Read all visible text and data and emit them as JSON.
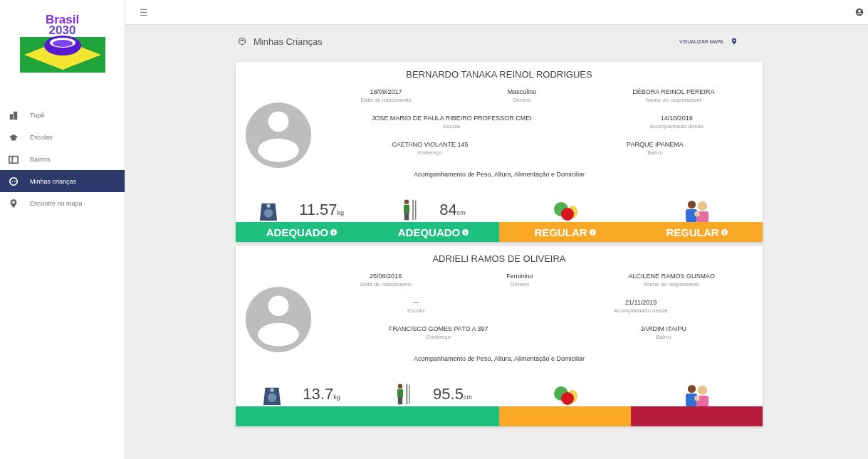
{
  "logo": {
    "line_1": "Brasil",
    "line_2": "2030"
  },
  "sidebar": {
    "items": [
      {
        "label": "Tupã",
        "kind": "city",
        "selected": false
      },
      {
        "label": "Escolas",
        "kind": "school",
        "selected": false
      },
      {
        "label": "Bairros",
        "kind": "map",
        "selected": false
      },
      {
        "label": "Minhas crianças",
        "kind": "child",
        "selected": true
      },
      {
        "label": "Encontre no mapa",
        "kind": "pin",
        "selected": false
      }
    ]
  },
  "topbar": {
    "menu_icon": "☰"
  },
  "page": {
    "title": "Minhas Crianças",
    "map_link": "VISUALIZAR MAPA"
  },
  "children": [
    {
      "name": "BERNARDO TANAKA REINOL RODRIGUES",
      "fields": [
        [
          {
            "value": "18/09/2017",
            "label": "Data de nascimento"
          },
          {
            "value": "Masculino",
            "label": "Gênero"
          },
          {
            "value": "DÉBORA REINOL PEREIRA",
            "label": "Nome do responsável"
          }
        ],
        [
          {
            "value": "JOSE MARIO DE PAULA RIBEIRO PROFESSOR CMEI",
            "label": "Escola"
          },
          {
            "value": "14/10/2019",
            "label": "Acompanhado desde"
          }
        ],
        [
          {
            "value": "CAETANO VIOLANTE 145",
            "label": "Endereço"
          },
          {
            "value": "PARQUE IPANEMA",
            "label": "Bairro"
          }
        ]
      ],
      "tracking": "Acompanhamento de Peso, Altura, Alimentação e Domiciliar",
      "indicators": [
        {
          "kind": "weight",
          "value": "11.57",
          "unit": "kg",
          "status": "ADEQUADO",
          "color": "#1ec07f"
        },
        {
          "kind": "height",
          "value": "84",
          "unit": "cm",
          "status": "ADEQUADO",
          "color": "#1ec07f"
        },
        {
          "kind": "food",
          "status": "REGULAR",
          "color": "#f9a825"
        },
        {
          "kind": "home",
          "status": "REGULAR",
          "color": "#f9a825"
        }
      ]
    },
    {
      "name": "ADRIELI RAMOS DE OLIVEIRA",
      "fields": [
        [
          {
            "value": "25/08/2016",
            "label": "Data de nascimento"
          },
          {
            "value": "Feminino",
            "label": "Gênero"
          },
          {
            "value": "ALCILENE RAMOS GUSMAO",
            "label": "Nome do responsável"
          }
        ],
        [
          {
            "value": "---",
            "label": "Escola"
          },
          {
            "value": "21/11/2019",
            "label": "Acompanhado desde"
          }
        ],
        [
          {
            "value": "FRANCISCO GOMES PATO A 397",
            "label": "Endereço"
          },
          {
            "value": "JARDIM ITAIPU",
            "label": "Bairro"
          }
        ]
      ],
      "tracking": "Acompanhamento de Peso, Altura, Alimentação e Domiciliar",
      "indicators": [
        {
          "kind": "weight",
          "value": "13.7",
          "unit": "kg",
          "color": "#1ec07f"
        },
        {
          "kind": "height",
          "value": "95.5",
          "unit": "cm",
          "color": "#1ec07f"
        },
        {
          "kind": "food",
          "color": "#f9a825"
        },
        {
          "kind": "home",
          "color": "#b71c3c"
        }
      ]
    }
  ]
}
